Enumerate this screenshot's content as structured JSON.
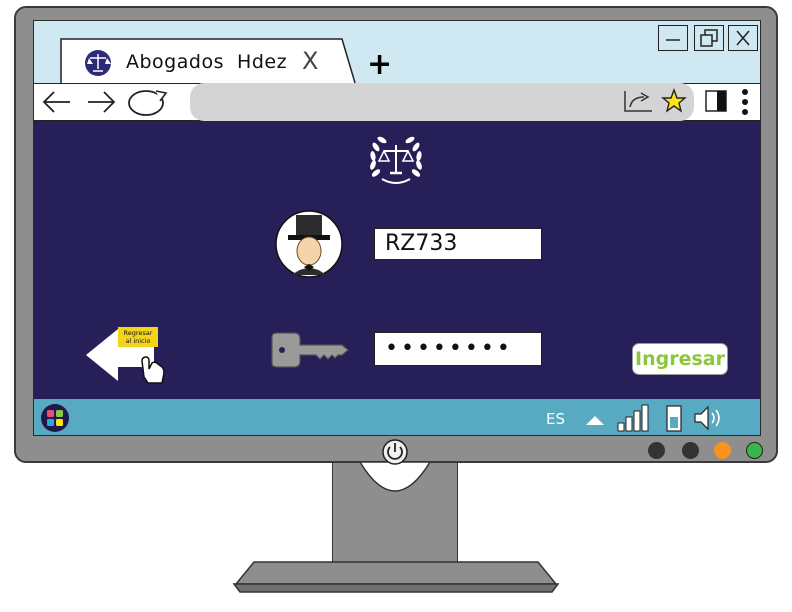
{
  "browser": {
    "tab": {
      "title": "Abogados  Hdez",
      "close_glyph": "X",
      "icon": "law-scales-laurel-icon"
    },
    "new_tab_glyph": "+",
    "window_controls": [
      "minimize-icon",
      "restore-icon",
      "close-icon"
    ],
    "nav_icons": [
      "back-arrow-icon",
      "forward-arrow-icon",
      "refresh-icon"
    ],
    "toolbar_icons": [
      "share-icon",
      "bookmark-star-icon",
      "sidebar-icon",
      "more-menu-icon"
    ]
  },
  "login": {
    "logo_icon": "law-scales-laurel-icon",
    "user_avatar": "lawyer-top-hat-avatar",
    "username_value": "RZ733",
    "password_key_icon": "key-icon",
    "password_mask": "••••••••",
    "submit_label": "Ingresar",
    "back_button_label": "Regresar al inicio",
    "back_label_line1": "Regresar",
    "back_label_line2": "al inicio"
  },
  "taskbar": {
    "start_icon": "windows-start-icon",
    "language": "ES",
    "tray_icons": [
      "tray-arrow-icon",
      "signal-icon",
      "battery-icon",
      "volume-icon"
    ]
  },
  "monitor": {
    "led_colors": [
      "#333333",
      "#333333",
      "#f7931e",
      "#39b54a"
    ],
    "power_icon": "power-button-icon"
  },
  "colors": {
    "screen_background": "#261f58",
    "tab_bar": "#cfe8f2",
    "taskbar": "#58a9c2",
    "submit_text": "#8cc63f",
    "back_label_bg": "#f2d51b"
  }
}
